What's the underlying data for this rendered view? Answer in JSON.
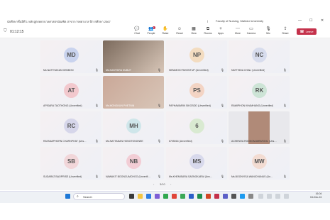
{
  "window": {
    "meeting_title": "นักศึกษาชั้นปีที่ 1 หลักสูตรพยาบาลศาสตรบัณฑิต สาขาการพยาบาล ปีการศึกษา 2567",
    "separator": "|",
    "org": "Faculty of Nursing, Mahidol University",
    "min": "—",
    "max": "☐",
    "close": "✕"
  },
  "toolbar": {
    "timer": "01:12:15",
    "items": [
      {
        "label": "Chat",
        "icon": "chat-icon",
        "glyph": "💬"
      },
      {
        "label": "People",
        "icon": "people-icon",
        "glyph": "👥"
      },
      {
        "label": "Raise",
        "icon": "hand-icon",
        "glyph": "✋"
      },
      {
        "label": "React",
        "icon": "react-icon",
        "glyph": "☺"
      },
      {
        "label": "View",
        "icon": "view-icon",
        "glyph": "▦"
      },
      {
        "label": "Rooms",
        "icon": "rooms-icon",
        "glyph": "⧉"
      },
      {
        "label": "Apps",
        "icon": "apps-icon",
        "glyph": "+"
      },
      {
        "label": "More",
        "icon": "more-icon",
        "glyph": "⋯"
      },
      {
        "label": "Camera",
        "icon": "camera-icon",
        "glyph": "▭"
      },
      {
        "label": "Mic",
        "icon": "mic-icon",
        "glyph": "🎙"
      },
      {
        "label": "Share",
        "icon": "share-icon",
        "glyph": "⇪"
      }
    ],
    "leave_label": "Leave",
    "people_badge": "1"
  },
  "participants": [
    {
      "initials": "MD",
      "name": "Ms.NATTHAKAN DENBON",
      "type": "avatar",
      "bg": "#c9d3ee"
    },
    {
      "initials": "",
      "name": "Ms.KANTSIRA NUBUT",
      "type": "video",
      "bg": "#7b6a5c"
    },
    {
      "initials": "NP",
      "name": "NIRAMON PAHONTUP (Unverified)",
      "type": "avatar",
      "bg": "#f3dcc0"
    },
    {
      "initials": "NC",
      "name": "NATTHIDA CHALI (Unverified)",
      "type": "avatar",
      "bg": "#d7dced"
    },
    {
      "initials": "AT",
      "name": "APISARA TAOTHONG (Unverified)",
      "type": "avatar",
      "bg": "#f2c8cd"
    },
    {
      "initials": "",
      "name": "Ms.MONGKUN PHETNIN",
      "type": "video",
      "bg": "#caa898"
    },
    {
      "initials": "PS",
      "name": "PAPHAWARIN SIKOSOD (Unverified)",
      "type": "avatar",
      "bg": "#f3d4c4"
    },
    {
      "initials": "RK",
      "name": "RAWIPHON KHAMHANG (Unverified)",
      "type": "avatar",
      "bg": "#cde4d6"
    },
    {
      "initials": "RC",
      "name": "RATANAPHORN CHARNPHAT (Uns…",
      "type": "avatar",
      "bg": "#d6d6ea"
    },
    {
      "initials": "MH",
      "name": "Ms.NATTANAN HONGTONGNEE",
      "type": "avatar",
      "bg": "#cfe6ea"
    },
    {
      "initials": "6",
      "name": "6705016 (Unverified)",
      "type": "avatar",
      "bg": "#d9ead1"
    },
    {
      "initials": "",
      "name": "ACHIRAYA RODSOMJARATOOL (Uns…",
      "type": "video",
      "bg": "#b08a78"
    },
    {
      "initials": "SB",
      "name": "SUDARAT BAOPRISE (Unverified)",
      "type": "avatar",
      "bg": "#f1d6d9"
    },
    {
      "initials": "NB",
      "name": "NAWAKIT BOONCUMCHOO (Unverifi…",
      "type": "avatar",
      "bg": "#f2cdd5"
    },
    {
      "initials": "MS",
      "name": "Ms.KHEMISARA SAENGKAEW (Unv…",
      "type": "avatar",
      "bg": "#d8d9ec"
    },
    {
      "initials": "MW",
      "name": "Ms.BOONYISA WANICHANUS (Un…",
      "type": "avatar",
      "bg": "#f3dcd2"
    }
  ],
  "pager": {
    "text": "3/10",
    "prev": "‹",
    "next": "›"
  },
  "taskbar": {
    "search_placeholder": "Search",
    "time": "16:04",
    "date": "04-Dec-24"
  },
  "colors": {
    "accent": "#5b5fc7",
    "leave": "#c4314b"
  }
}
